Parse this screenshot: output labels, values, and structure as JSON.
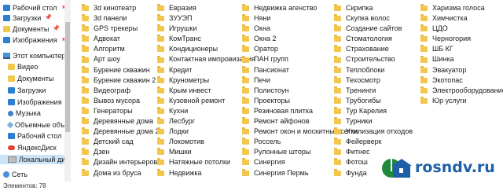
{
  "nav": {
    "items": [
      {
        "label": "Рабочий стол",
        "icon": "desktop-folder-icon",
        "pinned": true
      },
      {
        "label": "Загрузки",
        "icon": "downloads-folder-icon",
        "pinned": true
      },
      {
        "label": "Документы",
        "icon": "documents-folder-icon",
        "pinned": true
      },
      {
        "label": "Изображения",
        "icon": "pictures-folder-icon",
        "pinned": true
      },
      {
        "label": "Этот компьютер",
        "icon": "computer-icon"
      },
      {
        "label": "Видео",
        "icon": "video-folder-icon"
      },
      {
        "label": "Документы",
        "icon": "documents-folder-icon"
      },
      {
        "label": "Загрузки",
        "icon": "downloads-folder-icon"
      },
      {
        "label": "Изображения",
        "icon": "pictures-folder-icon"
      },
      {
        "label": "Музыка",
        "icon": "music-icon"
      },
      {
        "label": "Объемные объ",
        "icon": "3d-objects-icon"
      },
      {
        "label": "Рабочий стол",
        "icon": "desktop-folder-icon"
      },
      {
        "label": "ЯндексДиск",
        "icon": "yandex-disk-icon"
      },
      {
        "label": "Локальный дис",
        "icon": "local-disk-icon",
        "selected": true
      },
      {
        "label": "Сеть",
        "icon": "network-icon"
      }
    ]
  },
  "status": {
    "text": "Элементов: 78"
  },
  "columns": [
    [
      "3d кинотеатр",
      "3d панели",
      "GPS трекеры",
      "Адвокат",
      "Алгоритм",
      "Арт шоу",
      "Бурение скважин",
      "Бурение скважин 2",
      "Видеограф",
      "Вывоз мусора",
      "Генераторы",
      "Деревянные дома",
      "Деревянные дома 2",
      "Детский сад",
      "Дзен",
      "Дизайн интерьеров",
      "Дома из бруса"
    ],
    [
      "Евразия",
      "ЗУУЭП",
      "Игрушки",
      "КомТранс",
      "Кондиционеры",
      "Контактная импровизация",
      "Кредит",
      "Крунометры",
      "Крым инвест",
      "Кузовной ремонт",
      "Кухни",
      "Лесбург",
      "Лодки",
      "Локомотив",
      "Мишки",
      "Натяжные потолки",
      "Недвижка"
    ],
    [
      "Недвижка агенство",
      "Няни",
      "Окна",
      "Окна 2",
      "Оратор",
      "ПАН групп",
      "Пансионат",
      "Печи",
      "Полистоун",
      "Проекторы",
      "Резиновая плитка",
      "Ремонт айфонов",
      "Ремонт окон и москитные сетки",
      "Россель",
      "Рулонные шторы",
      "Синергия",
      "Синергия Пермь"
    ],
    [
      "Скрипка",
      "Скупка волос",
      "Создание сайтов",
      "Стоматология",
      "Страхование",
      "Строительство",
      "Теплоблоки",
      "Техосмотр",
      "Тренинги",
      "Трубогибы",
      "Тур Карелия",
      "Турники",
      "Утилизация отходов",
      "Фейерверк",
      "Фитнес",
      "Фотош",
      "Фунда"
    ],
    [
      "Харизма голоса",
      "Химчистка",
      "ЦДО",
      "Черногория",
      "ШБ КГ",
      "Шинка",
      "Эвакуатор",
      "Экотопас",
      "Электрооборудование",
      "Юр услуги"
    ]
  ],
  "watermark": {
    "text": "rosndv.ru"
  }
}
